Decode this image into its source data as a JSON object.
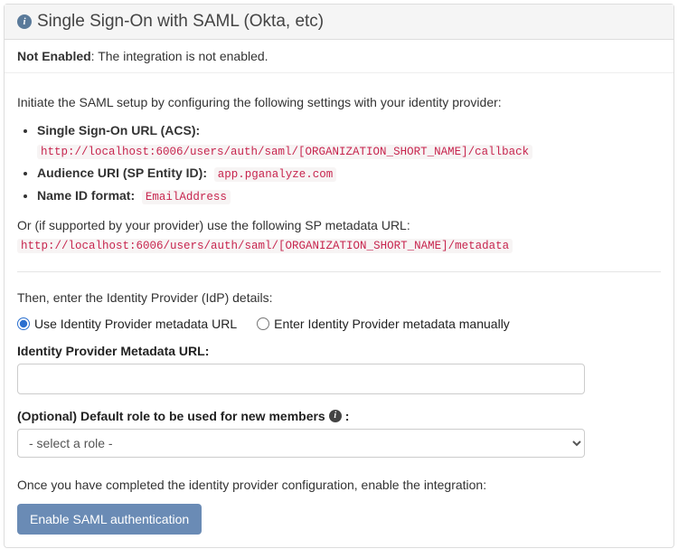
{
  "header": {
    "title": "Single Sign-On with SAML (Okta, etc)"
  },
  "status": {
    "label": "Not Enabled",
    "message": ": The integration is not enabled."
  },
  "setup": {
    "intro": "Initiate the SAML setup by configuring the following settings with your identity provider:",
    "sso_url_label": "Single Sign-On URL (ACS):",
    "sso_url_value": "http://localhost:6006/users/auth/saml/[ORGANIZATION_SHORT_NAME]/callback",
    "audience_label": "Audience URI (SP Entity ID):",
    "audience_value": "app.pganalyze.com",
    "nameid_label": "Name ID format:",
    "nameid_value": "EmailAddress",
    "alt_intro": "Or (if supported by your provider) use the following SP metadata URL:",
    "metadata_url": "http://localhost:6006/users/auth/saml/[ORGANIZATION_SHORT_NAME]/metadata"
  },
  "idp": {
    "intro": "Then, enter the Identity Provider (IdP) details:",
    "radio_url": "Use Identity Provider metadata URL",
    "radio_manual": "Enter Identity Provider metadata manually",
    "url_label": "Identity Provider Metadata URL:",
    "url_value": "",
    "role_label": "(Optional) Default role to be used for new members",
    "role_colon": ":",
    "role_placeholder": "- select a role -"
  },
  "footer": {
    "instruction": "Once you have completed the identity provider configuration, enable the integration:",
    "button": "Enable SAML authentication"
  }
}
